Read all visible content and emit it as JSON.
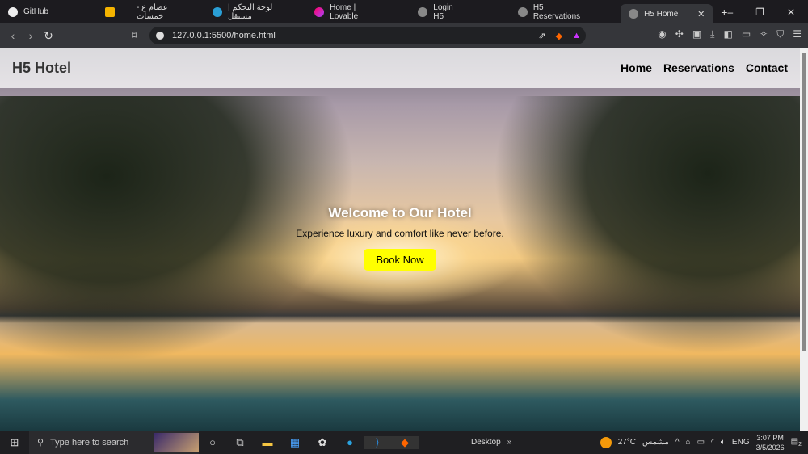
{
  "browser": {
    "tabs": [
      {
        "label": "GitHub",
        "active": false
      },
      {
        "label": "عصام ع - خمسات",
        "active": false
      },
      {
        "label": "لوحة التحكم | مستقل",
        "active": false
      },
      {
        "label": "Home | Lovable",
        "active": false
      },
      {
        "label": "Login H5",
        "active": false
      },
      {
        "label": "H5 Reservations",
        "active": false
      },
      {
        "label": "H5 Home",
        "active": true
      }
    ],
    "url": "127.0.0.1:5500/home.html"
  },
  "site": {
    "logo": "H5 Hotel",
    "nav": [
      "Home",
      "Reservations",
      "Contact"
    ],
    "hero_title": "Welcome to Our Hotel",
    "hero_subtitle": "Experience luxury and comfort like never before.",
    "cta": "Book Now"
  },
  "taskbar": {
    "search_placeholder": "Type here to search",
    "desktop": "Desktop",
    "weather": "27°C",
    "weather_desc": "مشمس",
    "lang": "ENG",
    "time": "3:07 PM",
    "date": "3/5/2026",
    "notifications": "2"
  }
}
